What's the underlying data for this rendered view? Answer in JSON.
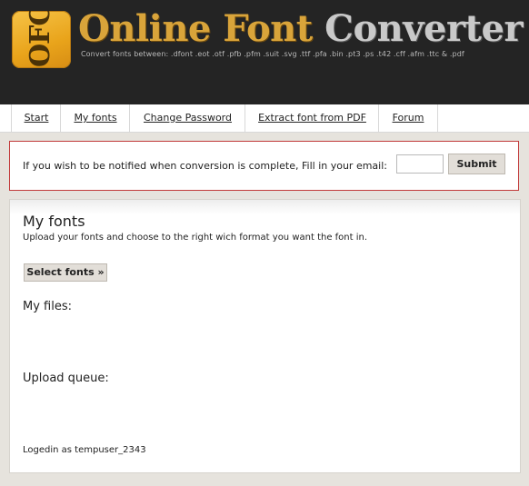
{
  "header": {
    "logo_text": "OFC",
    "title_part_a": "Online Font ",
    "title_part_b": "Converter",
    "tagline": "Convert fonts between: .dfont .eot .otf .pfb .pfm .suit .svg .ttf .pfa .bin .pt3 .ps .t42 .cff .afm .ttc & .pdf"
  },
  "nav": {
    "items": [
      {
        "label": "Start"
      },
      {
        "label": "My fonts"
      },
      {
        "label": "Change Password"
      },
      {
        "label": "Extract font from PDF"
      },
      {
        "label": "Forum"
      }
    ]
  },
  "notify": {
    "text": "If you wish to be notified when conversion is complete, Fill in your email:",
    "email_value": "",
    "submit_label": "Submit"
  },
  "main": {
    "heading": "My fonts",
    "subtext": "Upload your fonts and choose to the right wich format you want the font in.",
    "select_button": "Select fonts »",
    "my_files_label": "My files:",
    "upload_queue_label": "Upload queue:",
    "logged_in_text": "Logedin as tempuser_2343"
  }
}
